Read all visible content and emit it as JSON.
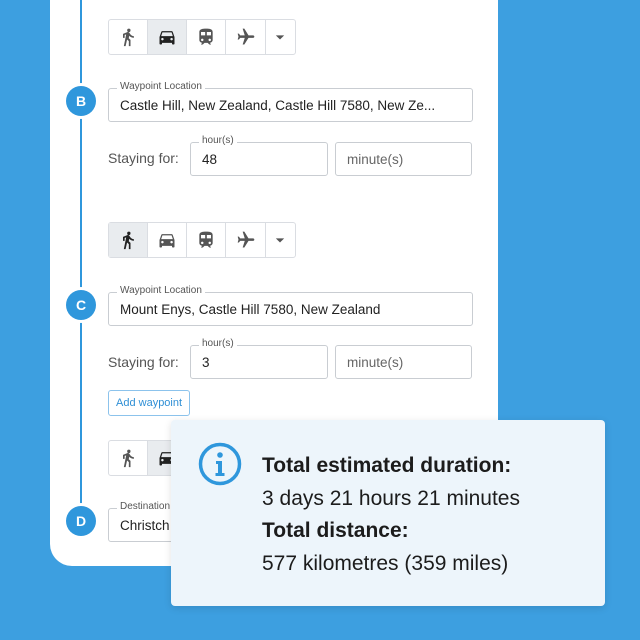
{
  "waypoints": [
    {
      "marker": "B",
      "location_label": "Waypoint Location",
      "location_value": "Castle Hill, New Zealand, Castle Hill 7580, New Ze...",
      "staying_label": "Staying for:",
      "hours_label": "hour(s)",
      "hours_value": "48",
      "minutes_placeholder": "minute(s)",
      "mode_active": "car"
    },
    {
      "marker": "C",
      "location_label": "Waypoint Location",
      "location_value": "Mount Enys, Castle Hill 7580, New Zealand",
      "staying_label": "Staying for:",
      "hours_label": "hour(s)",
      "hours_value": "3",
      "minutes_placeholder": "minute(s)",
      "mode_active": "walk"
    }
  ],
  "add_waypoint_label": "Add waypoint",
  "destination": {
    "marker": "D",
    "label": "Destination",
    "value": "Christch",
    "mode_active": "car"
  },
  "modes": [
    "walk-icon",
    "car-icon",
    "train-icon",
    "plane-icon",
    "chevron-down-icon"
  ],
  "summary": {
    "duration_label": "Total estimated duration:",
    "duration_value": "3 days 21 hours 21 minutes",
    "distance_label": "Total distance:",
    "distance_value": "577 kilometres (359 miles)"
  },
  "colors": {
    "background": "#3d9fe0",
    "accent": "#2f97dc",
    "info_box": "#edf5fb"
  }
}
